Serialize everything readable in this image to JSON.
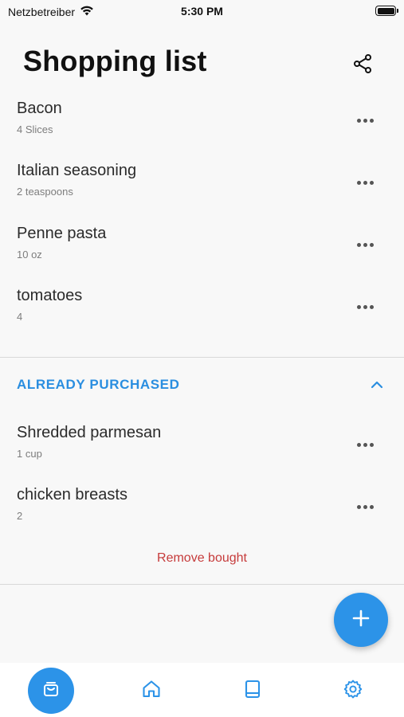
{
  "status_bar": {
    "carrier": "Netzbetreiber",
    "time": "5:30 PM"
  },
  "header": {
    "title": "Shopping list",
    "share_icon": "share-icon"
  },
  "items": [
    {
      "name": "Bacon",
      "quantity": "4 Slices"
    },
    {
      "name": "Italian seasoning",
      "quantity": "2 teaspoons"
    },
    {
      "name": "Penne pasta",
      "quantity": "10 oz"
    },
    {
      "name": "tomatoes",
      "quantity": "4"
    }
  ],
  "purchased_section": {
    "title": "ALREADY PURCHASED",
    "expanded": true,
    "items": [
      {
        "name": "Shredded parmesan",
        "quantity": "1 cup"
      },
      {
        "name": "chicken breasts",
        "quantity": "2"
      }
    ],
    "remove_label": "Remove bought"
  },
  "fab": {
    "icon": "plus-icon"
  },
  "bottom_nav": {
    "items": [
      {
        "icon": "shopping-bag-icon",
        "active": true
      },
      {
        "icon": "home-icon",
        "active": false
      },
      {
        "icon": "book-icon",
        "active": false
      },
      {
        "icon": "gear-icon",
        "active": false
      }
    ]
  },
  "colors": {
    "accent": "#2c93e8",
    "section_header": "#2a8ee0",
    "destructive": "#c63b3b",
    "background": "#f8f8f8"
  }
}
